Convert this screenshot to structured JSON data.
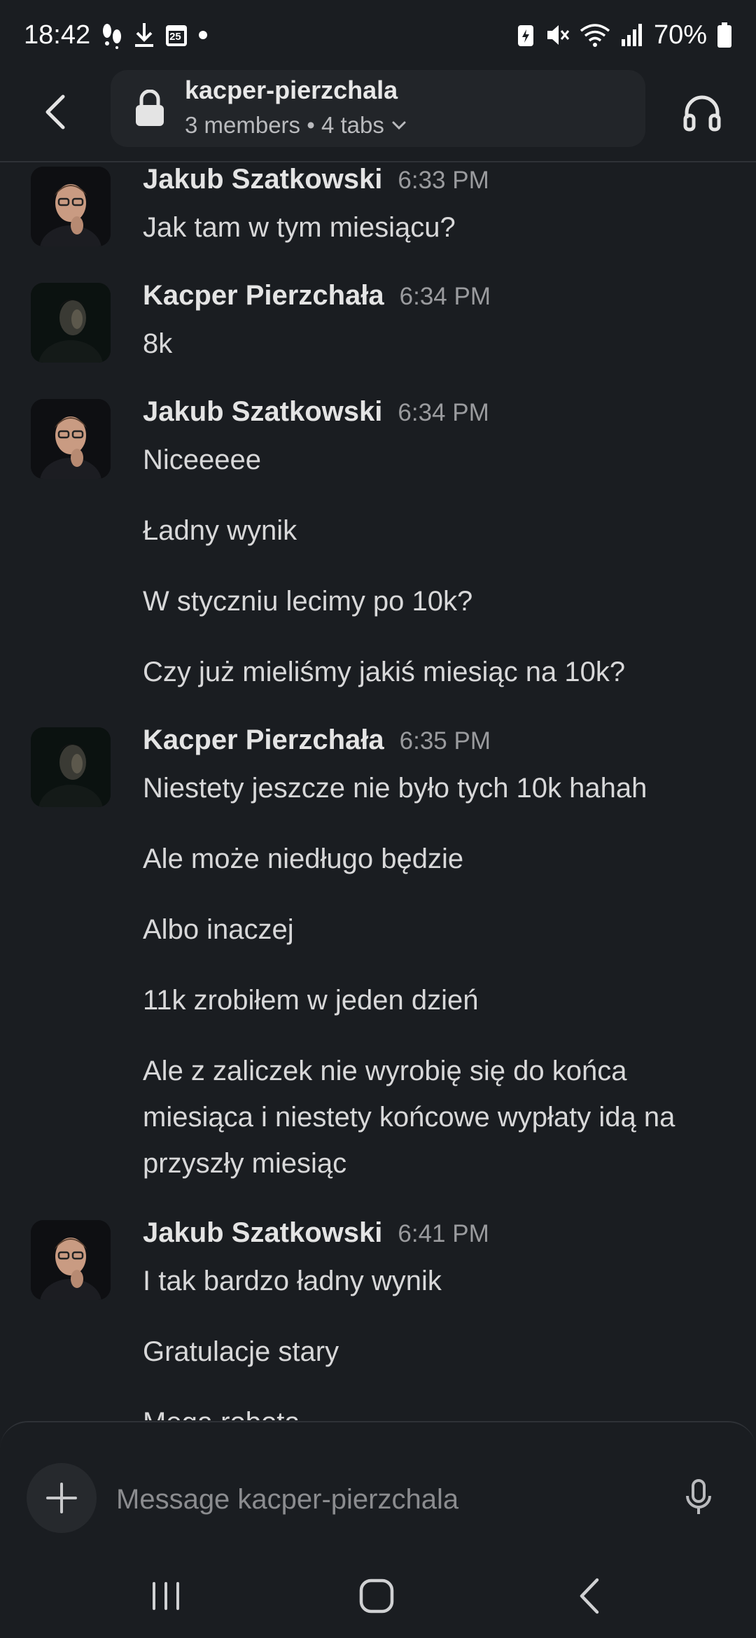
{
  "status_bar": {
    "time": "18:42",
    "calendar_day": "25",
    "battery": "70%",
    "icons_left": [
      "footsteps-icon",
      "download-icon",
      "calendar-icon",
      "dot-icon"
    ],
    "icons_right": [
      "battery-saver-icon",
      "mute-icon",
      "wifi-icon",
      "signal-icon",
      "battery-icon"
    ]
  },
  "header": {
    "channel_name": "kacper-pierzchala",
    "meta": "3 members • 4 tabs"
  },
  "messages": [
    {
      "author": "Jakub Szatkowski",
      "time": "6:33 PM",
      "avatar": "jakub",
      "lines": [
        "Jak tam w tym miesiącu?"
      ]
    },
    {
      "author": "Kacper Pierzchała",
      "time": "6:34 PM",
      "avatar": "kacper",
      "lines": [
        "8k"
      ]
    },
    {
      "author": "Jakub Szatkowski",
      "time": "6:34 PM",
      "avatar": "jakub",
      "lines": [
        "Niceeeee",
        "Ładny wynik",
        "W styczniu lecimy po 10k?",
        "Czy już mieliśmy jakiś miesiąc na 10k?"
      ]
    },
    {
      "author": "Kacper Pierzchała",
      "time": "6:35 PM",
      "avatar": "kacper",
      "lines": [
        "Niestety jeszcze nie było tych 10k hahah",
        "Ale może niedługo będzie",
        "Albo inaczej",
        "11k zrobiłem w jeden dzień",
        "Ale z zaliczek nie wyrobię się do końca miesiąca i niestety końcowe wypłaty idą na przyszły miesiąc"
      ]
    },
    {
      "author": "Jakub Szatkowski",
      "time": "6:41 PM",
      "avatar": "jakub",
      "lines": [
        "I tak bardzo ładny wynik",
        "Gratulacje stary",
        "Mega robota"
      ]
    }
  ],
  "composer": {
    "placeholder": "Message kacper-pierzchala"
  },
  "colors": {
    "background": "#1a1d21",
    "pill": "#222529",
    "text": "#d8d8d9",
    "muted": "#9a9b9e"
  }
}
